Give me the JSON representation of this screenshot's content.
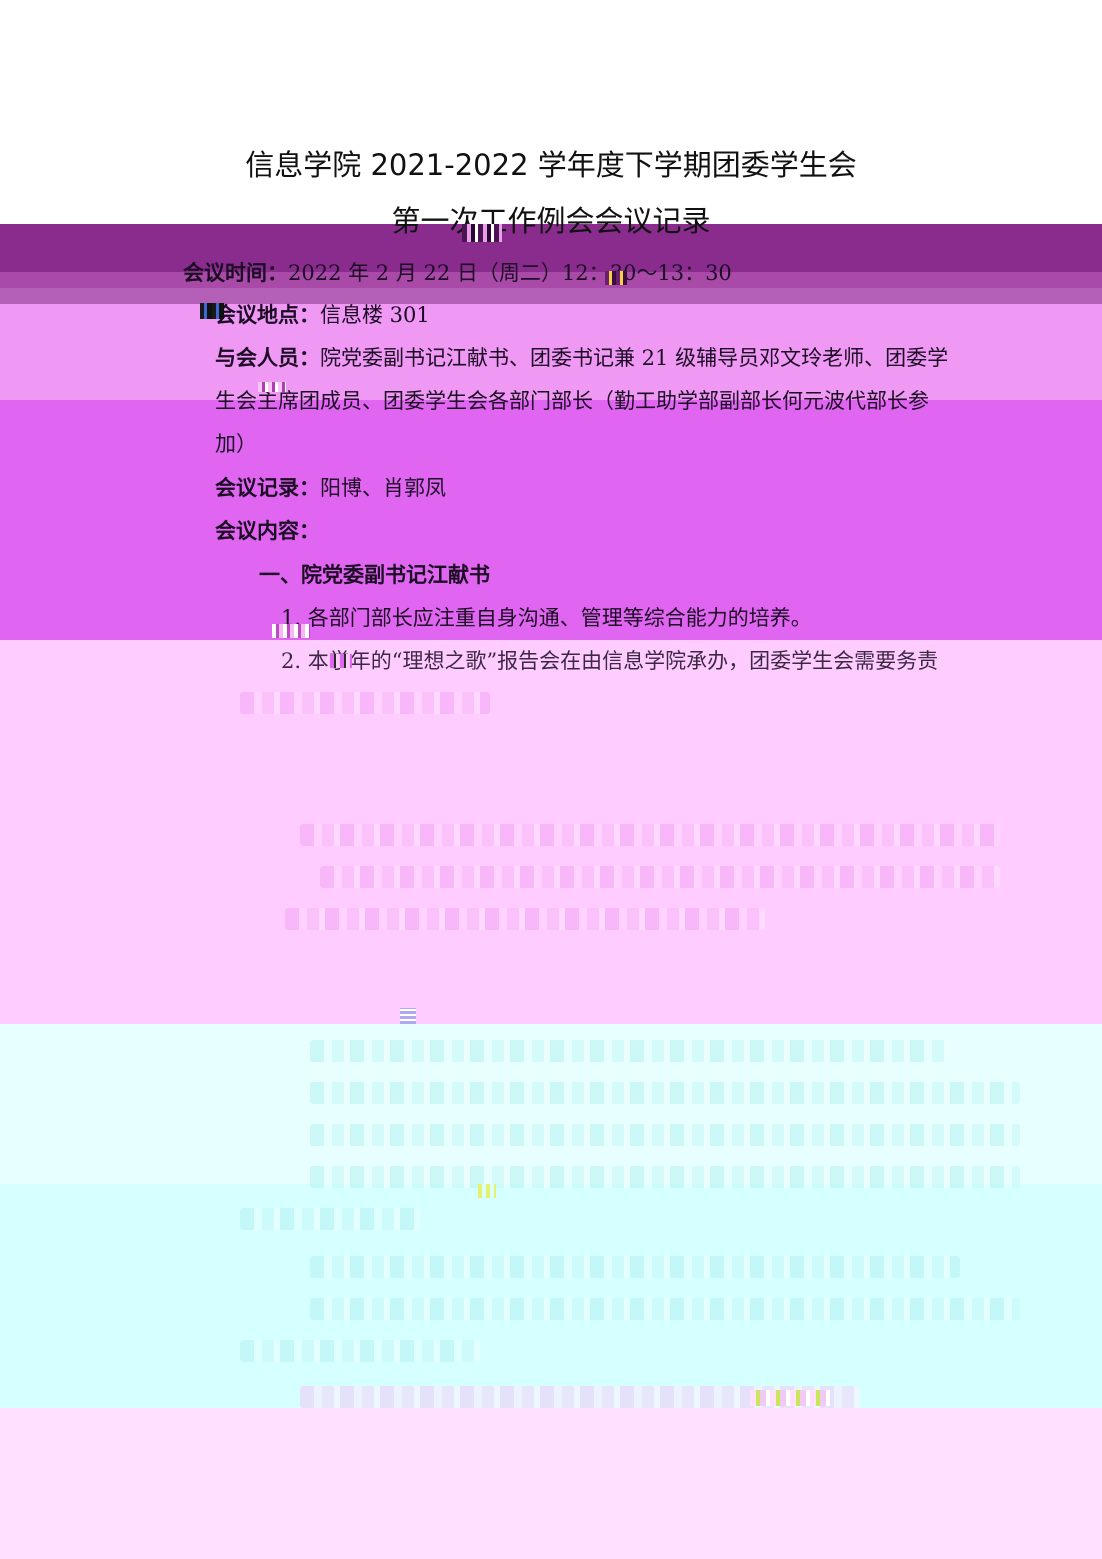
{
  "document": {
    "title_line1": "信息学院 2021-2022 学年度下学期团委学生会",
    "title_line2": "第一次工作例会会议记录",
    "meeting_time": {
      "label": "会议时间：",
      "value": "2022 年 2 月 22 日（周二）12：30～13：30"
    },
    "meeting_place": {
      "label": "会议地点：",
      "value": "信息楼 301"
    },
    "attendees": {
      "label": "与会人员：",
      "value_line1": "院党委副书记江献书、团委书记兼 21 级辅导员邓文玲老师、团委学",
      "value_line2": "生会主席团成员、团委学生会各部门部长（勤工助学部副部长何元波代部长参",
      "value_line3": "加）"
    },
    "recorder": {
      "label": "会议记录：",
      "value": "阳博、肖郭凤"
    },
    "content_label": "会议内容：",
    "section1": {
      "heading": "一、院党委副书记江献书",
      "item1": "1. 各部门部长应注重自身沟通、管理等综合能力的培养。",
      "item2": "2. 本学年的“理想之歌”报告会在由信息学院承办，团委学生会需要务责"
    }
  },
  "colors": {
    "band_dark_purple": "#8a2c8e",
    "band_pink": "#ef98f4",
    "band_magenta": "#e066f2",
    "band_light_pink": "#ffccff",
    "band_light_cyan": "#e8ffff",
    "band_cyan": "#d6ffff",
    "band_lavender": "#ffe0ff"
  }
}
